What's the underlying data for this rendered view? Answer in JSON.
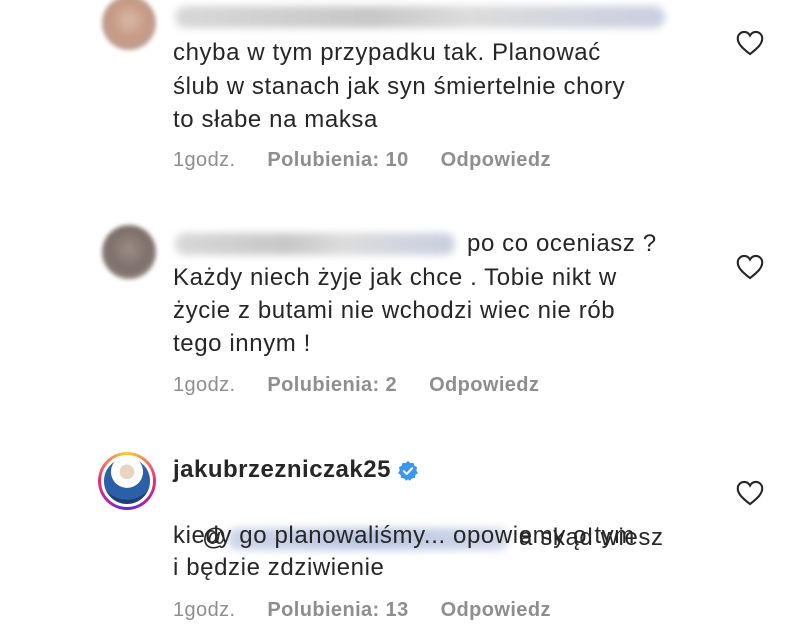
{
  "comments": [
    {
      "lines": [
        "chyba w tym przypadku tak. Planować",
        "ślub w stanach jak syn śmiertelnie chory",
        "to słabe na maksa"
      ],
      "time": "1godz.",
      "likes": "Polubienia: 10",
      "reply": "Odpowiedz"
    },
    {
      "first_line_tail": "po co oceniasz ?",
      "lines": [
        "Każdy niech żyje jak chce . Tobie nikt w",
        "życie z butami nie wchodzi wiec nie rób",
        "tego innym !"
      ],
      "time": "1godz.",
      "likes": "Polubienia: 2",
      "reply": "Odpowiedz"
    },
    {
      "username": "jakubrzezniczak25",
      "mention_prefix": "@",
      "first_line_tail": "a skąd wiesz",
      "lines": [
        "kiedy go planowaliśmy... opowiemy o tym",
        "i będzie zdziwienie"
      ],
      "time": "1godz.",
      "likes": "Polubienia: 13",
      "reply": "Odpowiedz"
    }
  ],
  "icons": {
    "like": "heart-outline-icon",
    "verified": "verified-badge-icon"
  },
  "colors": {
    "text": "#262626",
    "meta": "#8e8e8e",
    "verified": "#3897f0"
  }
}
